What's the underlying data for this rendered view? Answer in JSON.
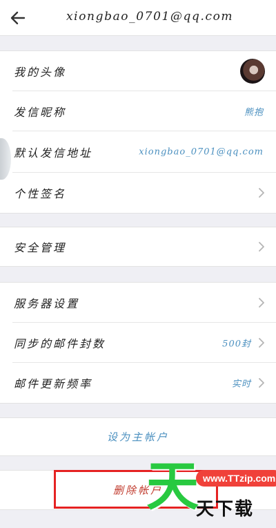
{
  "header": {
    "title": "xiongbao_0701@qq.com",
    "back_icon": "arrow-left-icon"
  },
  "profile": {
    "avatar_label": "我的头像",
    "nickname_label": "发信昵称",
    "nickname_value": "熊抱",
    "default_address_label": "默认发信地址",
    "default_address_value": "xiongbao_0701@qq.com",
    "signature_label": "个性签名"
  },
  "security": {
    "label": "安全管理"
  },
  "server": {
    "server_settings_label": "服务器设置",
    "sync_count_label": "同步的邮件封数",
    "sync_count_value": "500封",
    "update_freq_label": "邮件更新频率",
    "update_freq_value": "实时"
  },
  "actions": {
    "set_primary_label": "设为主帐户",
    "delete_label": "删除帐户"
  },
  "watermark": {
    "big_char": "天",
    "url": "www.TTzip.com",
    "text": "天下载"
  },
  "colors": {
    "accent": "#4a8fbf",
    "delete": "#c0392b",
    "highlight": "#e52222",
    "watermark_green": "#28c940",
    "watermark_red": "#f0413a"
  }
}
